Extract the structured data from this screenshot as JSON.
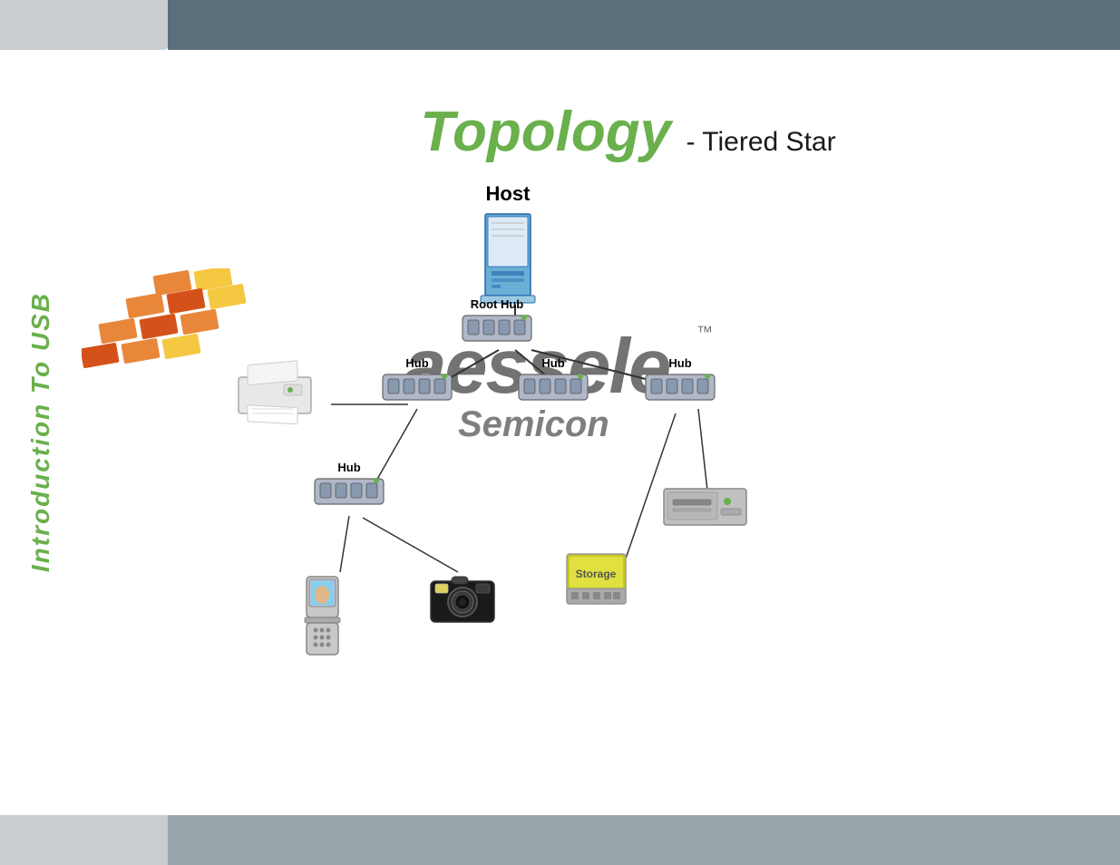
{
  "page": {
    "title": "Topology - Tiered Star",
    "topology_word": "Topology",
    "subtitle": "- Tiered Star",
    "sidebar_label": "Introduction To USB"
  },
  "diagram": {
    "nodes": {
      "host": {
        "label_top": "Host",
        "label_bottom": ""
      },
      "root_hub": {
        "label": "Root Hub"
      },
      "hub1": {
        "label": "Hub"
      },
      "hub2": {
        "label": "Hub"
      },
      "hub3": {
        "label": "Hub"
      },
      "hub4": {
        "label": "Hub"
      }
    },
    "watermark": {
      "brand": "aessele",
      "brand_tm": "™",
      "sub": "Semicon"
    }
  },
  "colors": {
    "green": "#6ab04c",
    "dark_gray": "#5a6f7c",
    "light_gray": "#c8cdd0",
    "mid_gray": "#9aa5ab"
  }
}
